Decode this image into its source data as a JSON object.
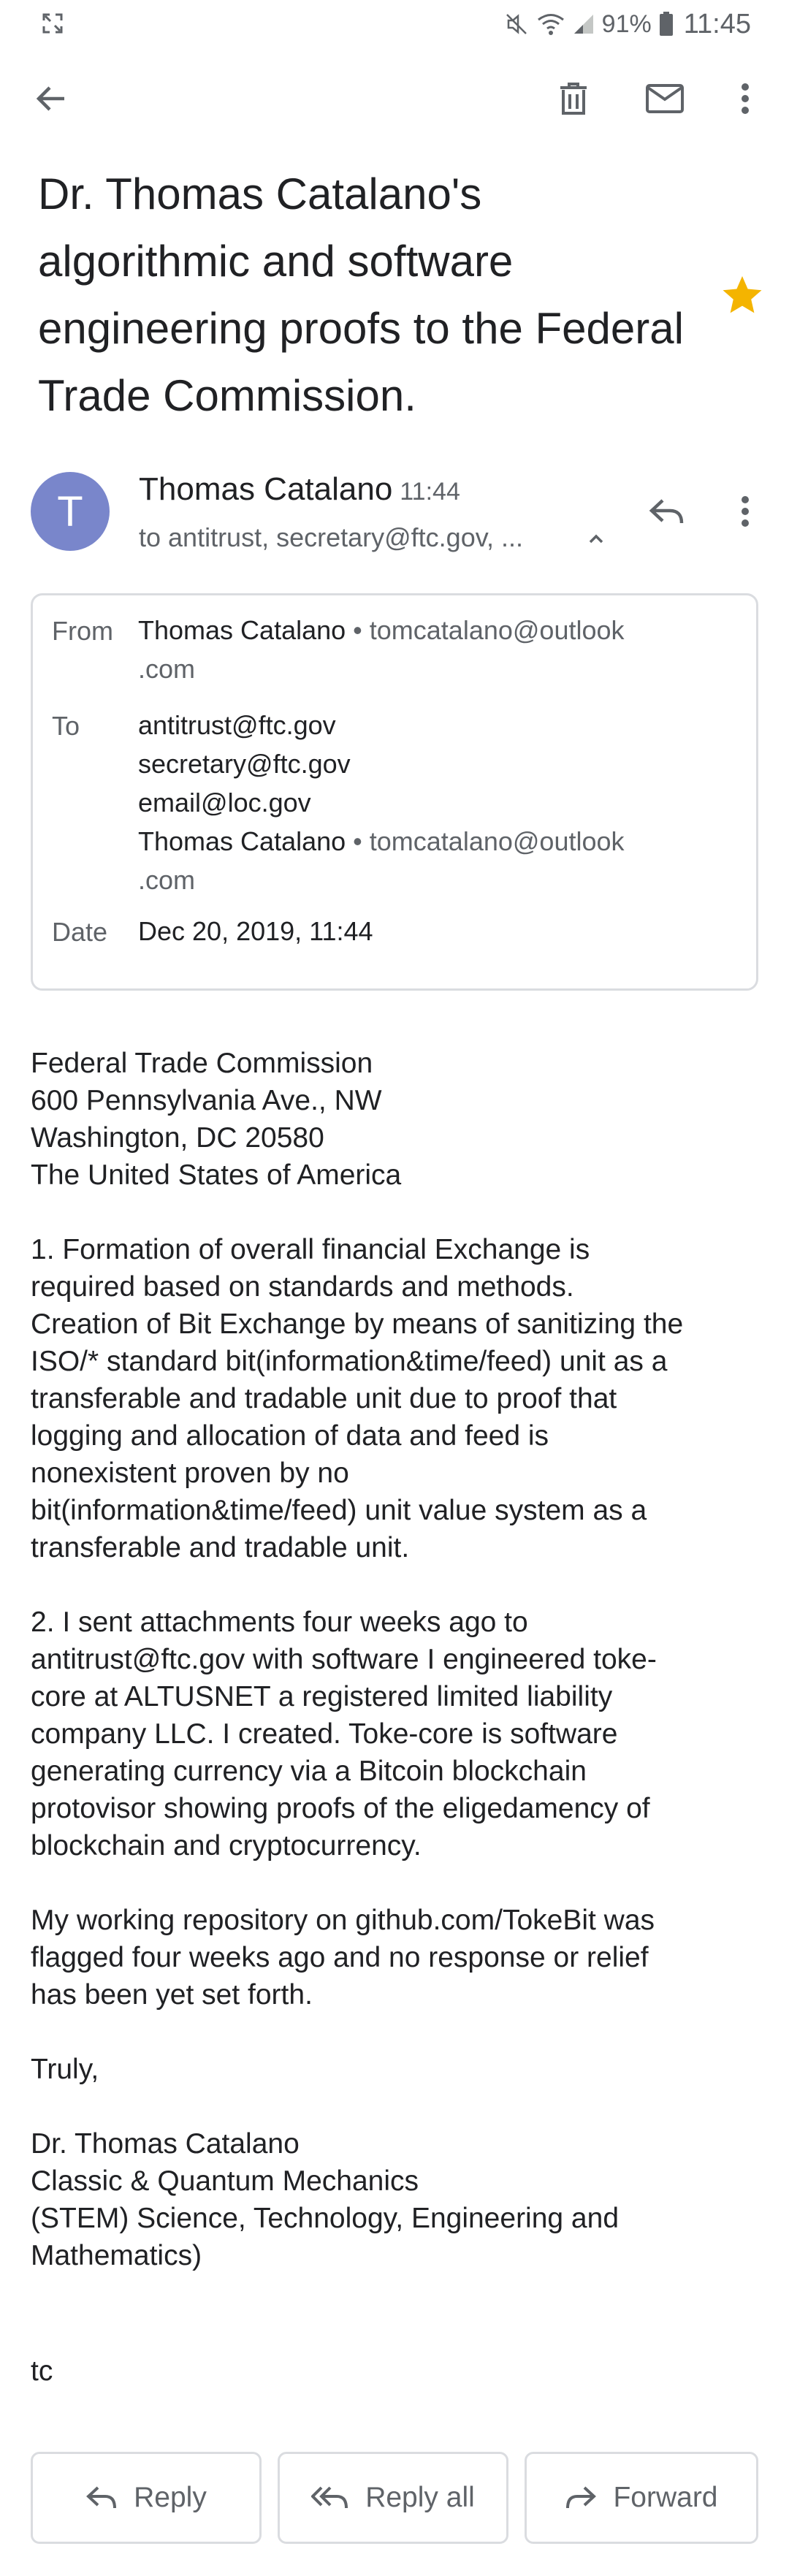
{
  "status_bar": {
    "battery_percent": "91%",
    "time": "11:45"
  },
  "subject": "Dr. Thomas Catalano's algorithmic and software engineering proofs to the Federal Trade Commission.",
  "sender": {
    "avatar_letter": "T",
    "avatar_color": "#7986cb",
    "name": "Thomas Catalano",
    "time": "11:44",
    "recipients_summary": "to antitrust, secretary@ftc.gov, ..."
  },
  "details": {
    "from_label": "From",
    "from_name": "Thomas Catalano",
    "from_separator": " • ",
    "from_email_line1": "tomcatalano@outlook",
    "from_email_line2": ".com",
    "to_label": "To",
    "to_list": [
      "antitrust@ftc.gov",
      "secretary@ftc.gov",
      "email@loc.gov"
    ],
    "to_last_name": "Thomas Catalano",
    "to_last_email_line1": "tomcatalano@outlook",
    "to_last_email_line2": ".com",
    "date_label": "Date",
    "date_value": "Dec 20, 2019, 11:44"
  },
  "body": {
    "address": [
      "Federal Trade Commission",
      "600 Pennsylvania Ave., NW",
      "Washington, DC 20580",
      "The United States of America"
    ],
    "para1": [
      "1. Formation of overall financial Exchange is",
      "required based on standards and methods.",
      "Creation of Bit Exchange by means of sanitizing the",
      "ISO/* standard bit(information&time/feed) unit as a",
      "transferable and tradable unit due to proof that",
      "logging and allocation of data and feed is",
      "nonexistent proven by no",
      "bit(information&time/feed) unit value system as a",
      "transferable and tradable unit."
    ],
    "para2": [
      "2.  I sent attachments four weeks ago to",
      "antitrust@ftc.gov with software I engineered toke-",
      "core at ALTUSNET a registered limited liability",
      "company LLC. I created. Toke-core is software",
      "generating currency via a Bitcoin blockchain",
      "protovisor showing proofs of the eligedamency of",
      "blockchain and cryptocurrency."
    ],
    "para3": [
      "My working repository on github.com/TokeBit was",
      "flagged four weeks ago and no response or relief",
      "has been yet set forth."
    ],
    "closing": "Truly,",
    "signature": [
      "Dr. Thomas Catalano",
      "Classic & Quantum Mechanics",
      "(STEM) Science, Technology, Engineering and",
      "Mathematics)"
    ],
    "signoff": "tc"
  },
  "actions": {
    "reply": "Reply",
    "reply_all": "Reply all",
    "forward": "Forward"
  },
  "colors": {
    "star": "#f4b400",
    "border": "#dadce0",
    "secondary_text": "#5f6368"
  }
}
